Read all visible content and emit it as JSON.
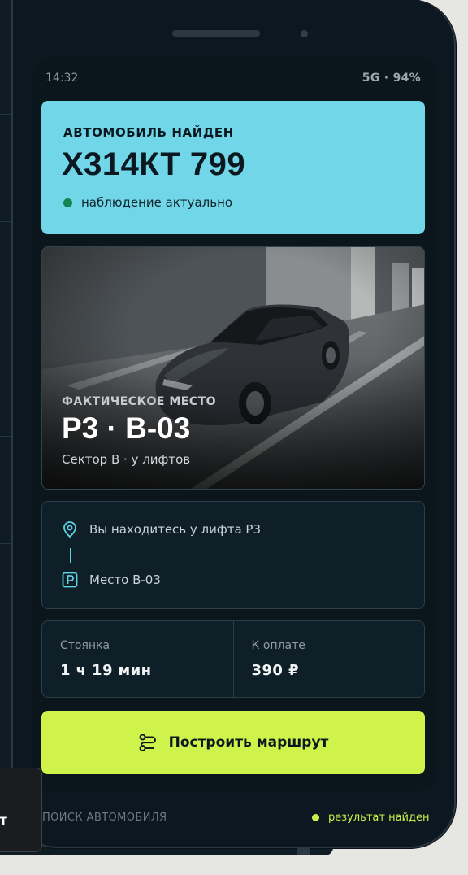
{
  "status": {
    "time": "14:32",
    "network": "5G · 94%"
  },
  "found": {
    "label": "АВТОМОБИЛЬ НАЙДЕН",
    "plate": "Х314КТ 799",
    "observation": "наблюдение актуально"
  },
  "photo": {
    "caption": "ФАКТИЧЕСКОЕ МЕСТО",
    "spot": "P3 · B-03",
    "sector": "Сектор B · у лифтов"
  },
  "route": {
    "from": "Вы находитесь у лифта P3",
    "to": "Место B-03"
  },
  "stats": {
    "parking_label": "Стоянка",
    "parking_value": "1 ч 19 мин",
    "payment_label": "К оплате",
    "payment_value": "390 ₽"
  },
  "button": {
    "label": "Построить маршрут"
  },
  "footer": {
    "left": "ПОИСК АВТОМОБИЛЯ",
    "right": "результат найден"
  },
  "side_popup": {
    "text": "т"
  },
  "colors": {
    "accent_cyan": "#71d6e8",
    "accent_lime": "#cff34a",
    "success_green": "#14854f",
    "screen_bg": "#0a151c"
  },
  "icons": {
    "location": "map-pin-icon",
    "parking": "parking-icon",
    "route": "route-icon"
  }
}
